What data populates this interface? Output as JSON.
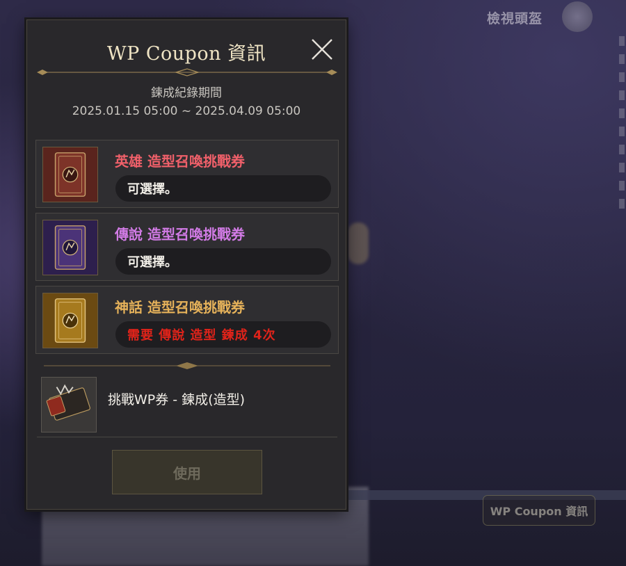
{
  "hud": {
    "title": "檢視頭盔",
    "coupon_button": "WP Coupon 資訊"
  },
  "panel": {
    "title": "WP Coupon 資訊",
    "period_label": "鍊成紀錄期間",
    "period_range": "2025.01.15 05:00 ~ 2025.04.09 05:00",
    "tickets": [
      {
        "name": "英雄 造型召喚挑戰券",
        "status": "可選擇。",
        "color": "#f0606a",
        "card_color": "#8a3a2c"
      },
      {
        "name": "傳說 造型召喚挑戰券",
        "status": "可選擇。",
        "color": "#d27be6",
        "card_color": "#5a3a8a"
      },
      {
        "name": "神話 造型召喚挑戰券",
        "status": "需要 傳說 造型 鍊成  4次",
        "color": "#e6b25a",
        "card_color": "#b58420"
      }
    ],
    "coupon_item": "挑戰WP券 - 鍊成(造型)",
    "use_button": "使用"
  }
}
